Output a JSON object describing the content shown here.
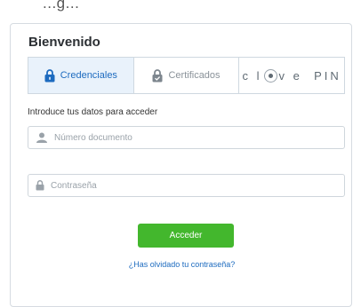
{
  "header": {
    "partial_text": "...g..."
  },
  "login": {
    "title": "Bienvenido",
    "tabs": [
      {
        "label": "Credenciales",
        "icon": "lock-icon",
        "active": true
      },
      {
        "label": "Certificados",
        "icon": "certificate-lock-icon",
        "active": false
      },
      {
        "label": "cl@ve PIN",
        "icon": "clave-pin-logo",
        "active": false
      }
    ],
    "intro": "Introduce tus datos para acceder",
    "user_field": {
      "placeholder": "Número documento",
      "value": "",
      "icon": "user-icon"
    },
    "password_field": {
      "placeholder": "Contraseña",
      "value": "",
      "icon": "lock-icon"
    },
    "submit_label": "Acceder",
    "forgot_link": "¿Has olvidado tu contraseña?"
  },
  "colors": {
    "accent_blue": "#1d6bbf",
    "active_tab_bg": "#e9f2fb",
    "submit_green": "#43b72d",
    "border": "#cfd8e0"
  }
}
